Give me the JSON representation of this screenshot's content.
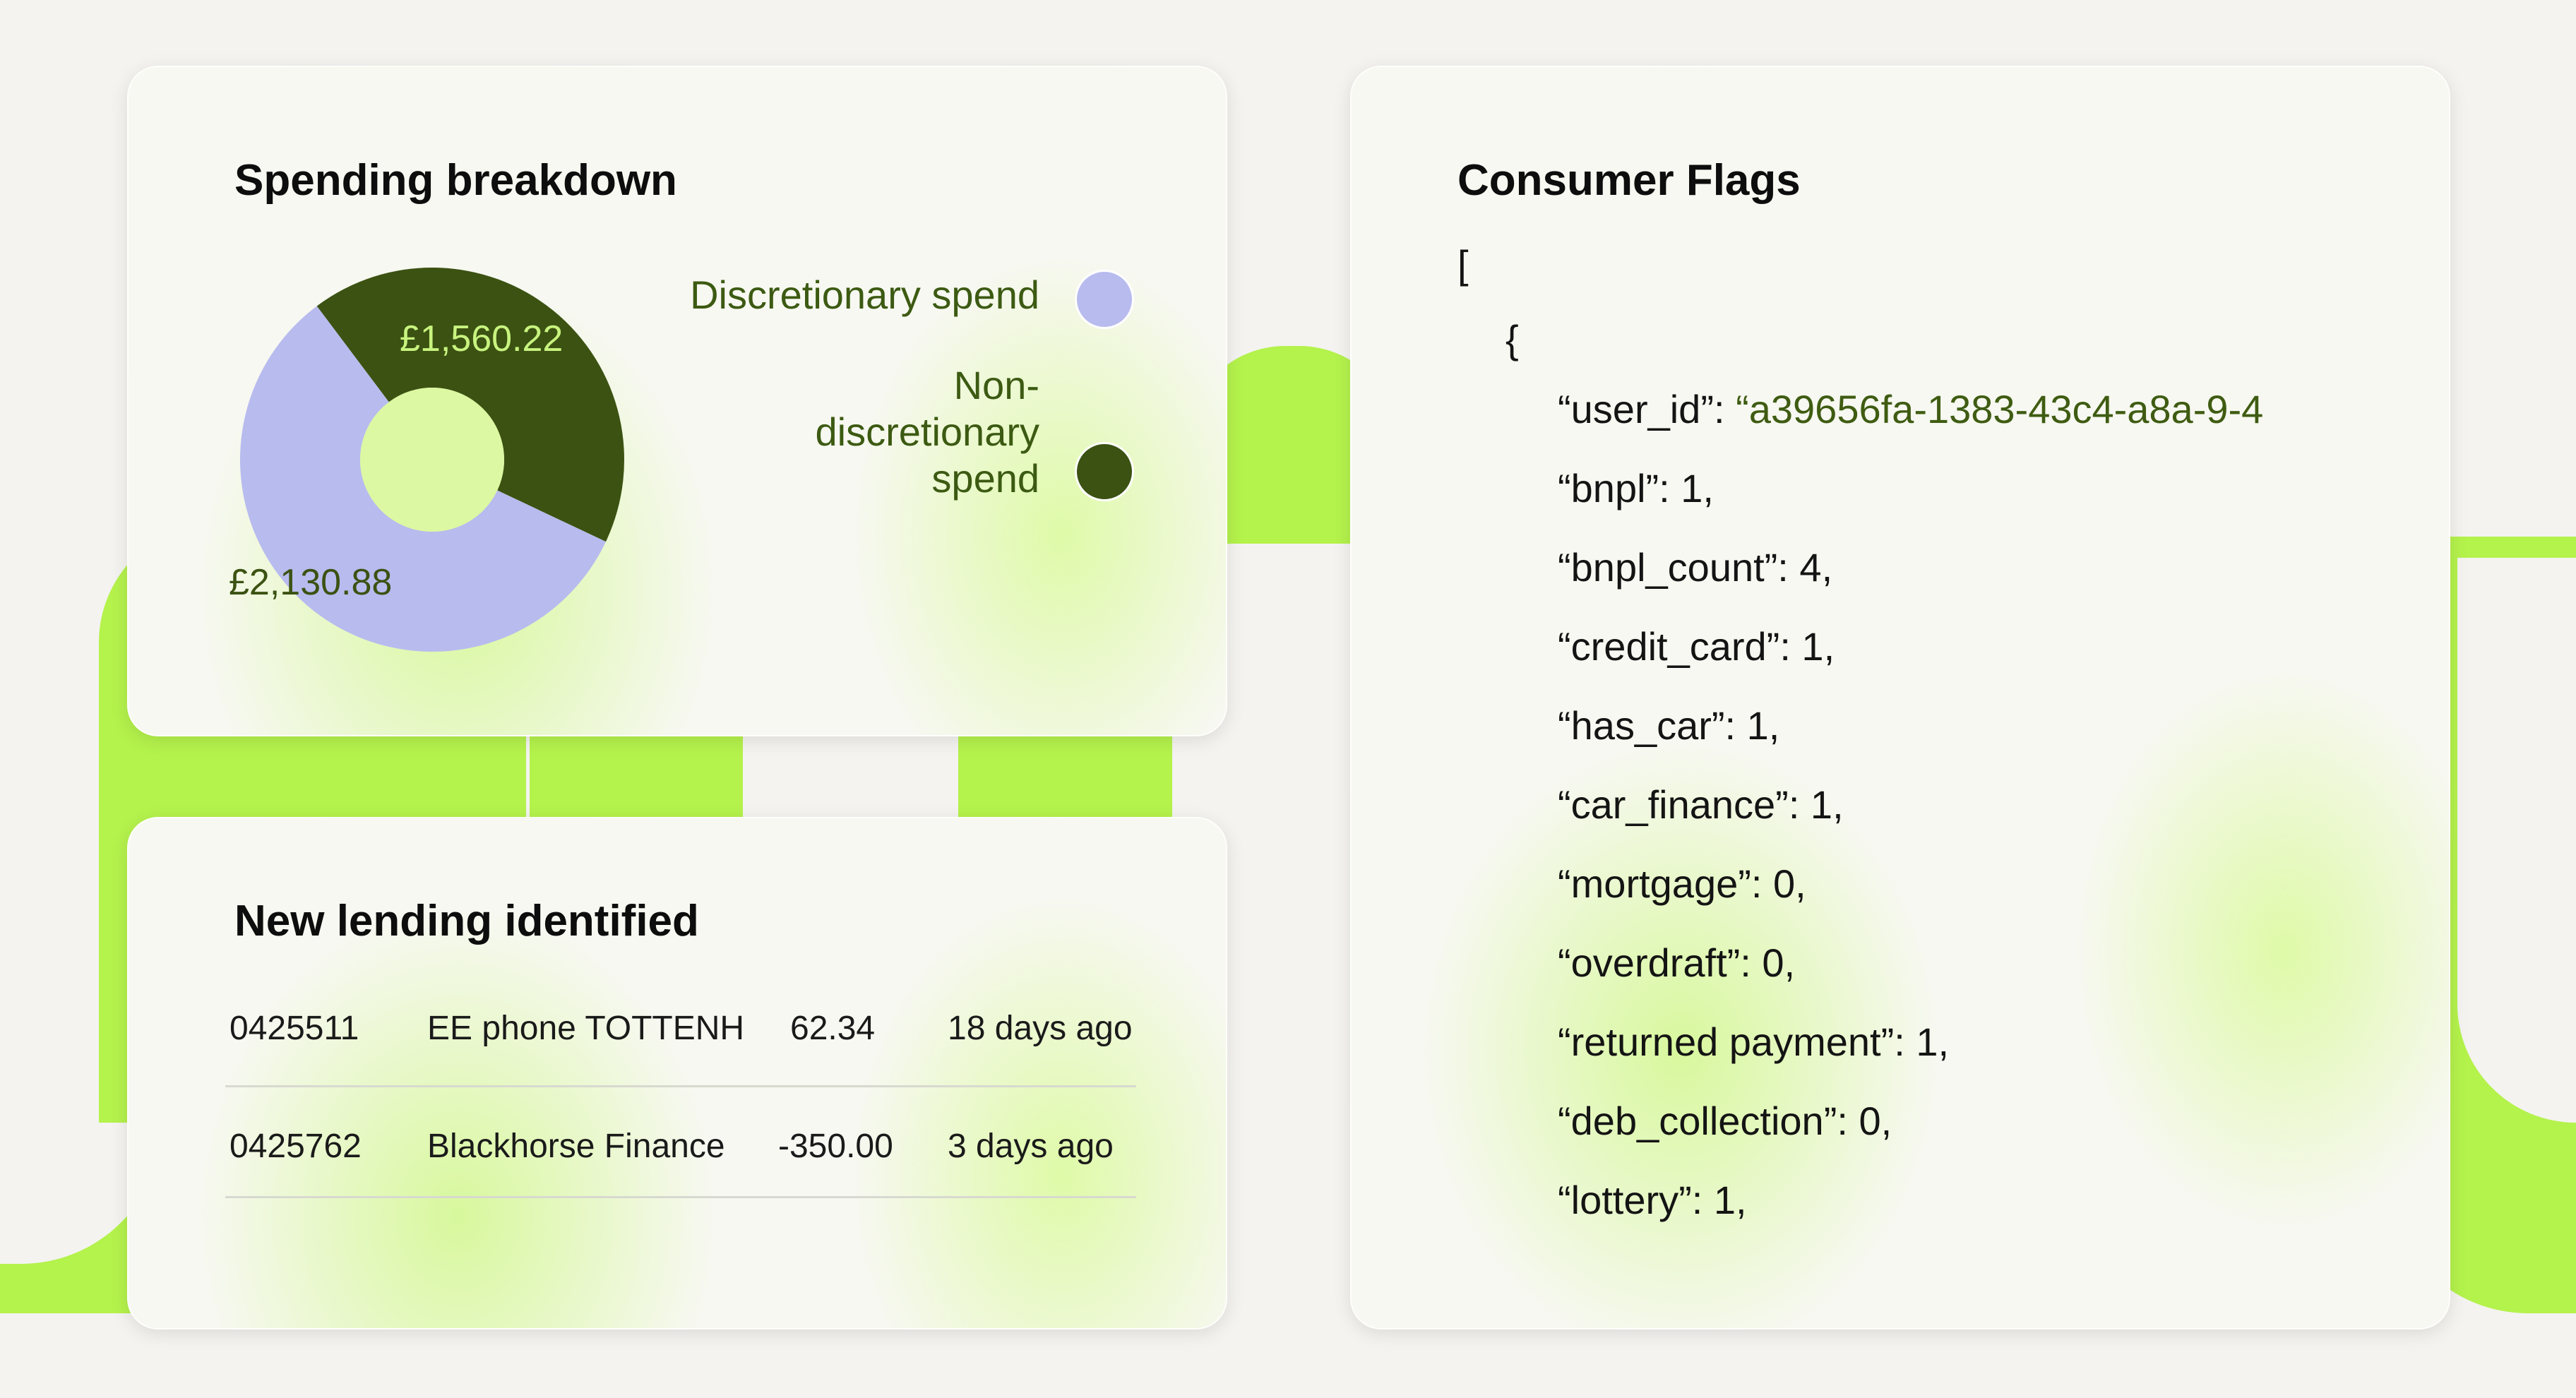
{
  "spending": {
    "title": "Spending breakdown",
    "legend": [
      {
        "label": "Discretionary spend",
        "color": "#b8bbee"
      },
      {
        "label": "Non-discretionary spend",
        "color": "#3b5212"
      }
    ],
    "values": {
      "non_discretionary": "£1,560.22",
      "discretionary": "£2,130.88"
    },
    "chart_data": {
      "type": "pie",
      "categories": [
        "Discretionary spend",
        "Non-discretionary spend"
      ],
      "values": [
        2130.88,
        1560.22
      ]
    }
  },
  "lending": {
    "title": "New lending identified",
    "rows": [
      {
        "id": "0425511",
        "merchant": "EE phone TOTTENH",
        "amount": "62.34",
        "when": "18 days ago"
      },
      {
        "id": "0425762",
        "merchant": "Blackhorse Finance",
        "amount": "-350.00",
        "when": "3 days ago"
      }
    ]
  },
  "flags": {
    "title": "Consumer Flags",
    "open_bracket": "[",
    "open_brace": "{",
    "user_id_key": "“user_id”: ",
    "user_id_value": "“a39656fa-1383-43c4-a8a-9-4",
    "entries": [
      "“bnpl”: 1,",
      "“bnpl_count”: 4,",
      "“credit_card”: 1,",
      "“has_car”: 1,",
      "“car_finance”: 1,",
      "“mortgage”: 0,",
      "“overdraft”: 0,",
      "“returned payment”: 1,",
      "“deb_collection”: 0,",
      "“lottery”: 1,"
    ]
  },
  "colors": {
    "accent": "#b4f24c",
    "background": "#f4f3f0",
    "discretionary": "#b8bbee",
    "non_discretionary": "#3b5212"
  }
}
